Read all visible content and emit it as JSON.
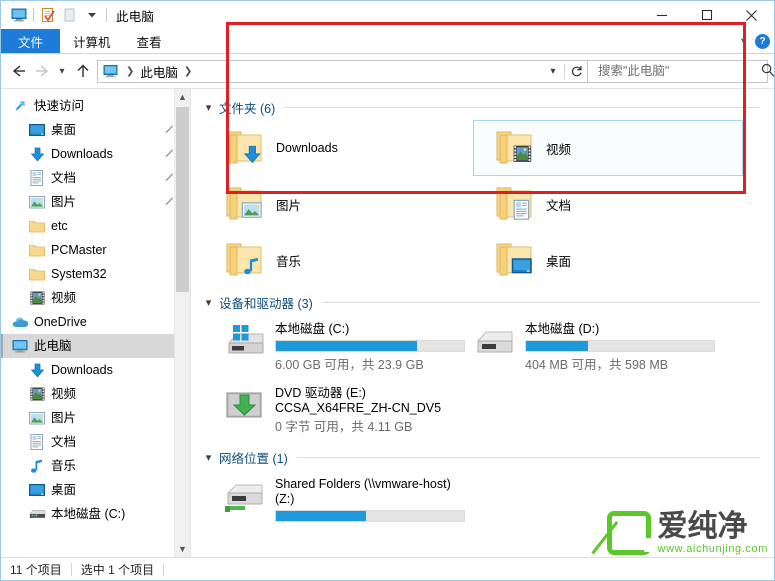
{
  "window": {
    "title": "此电脑",
    "quick_access_icons": [
      "monitor-icon",
      "properties-icon",
      "new-folder-icon",
      "customize-chevron-icon"
    ],
    "caption": {
      "minimize": "minimize-icon",
      "maximize": "maximize-icon",
      "close": "close-icon"
    }
  },
  "ribbon": {
    "tabs": [
      {
        "label": "文件",
        "active": true
      },
      {
        "label": "计算机",
        "active": false
      },
      {
        "label": "查看",
        "active": false
      }
    ],
    "expand_icon": "chevron-down-icon",
    "help_label": "?"
  },
  "nav": {
    "back": "back-arrow-icon",
    "forward": "forward-arrow-icon",
    "recent": "recent-chevron-icon",
    "up": "up-arrow-icon",
    "breadcrumb": {
      "root_icon": "this-pc-icon",
      "items": [
        "此电脑"
      ]
    },
    "history_icon": "chevron-down-icon",
    "refresh_icon": "refresh-icon"
  },
  "search": {
    "placeholder": "搜索\"此电脑\"",
    "value": "",
    "icon": "search-icon"
  },
  "sidebar": {
    "items": [
      {
        "label": "快速访问",
        "icon": "pin-star-icon",
        "indent": 0,
        "pinned": false,
        "selected": false
      },
      {
        "label": "桌面",
        "icon": "desktop-icon",
        "indent": 1,
        "pinned": true,
        "selected": false
      },
      {
        "label": "Downloads",
        "icon": "downloads-icon",
        "indent": 1,
        "pinned": true,
        "selected": false
      },
      {
        "label": "文档",
        "icon": "documents-icon",
        "indent": 1,
        "pinned": true,
        "selected": false
      },
      {
        "label": "图片",
        "icon": "pictures-icon",
        "indent": 1,
        "pinned": true,
        "selected": false
      },
      {
        "label": "etc",
        "icon": "folder-icon",
        "indent": 1,
        "pinned": false,
        "selected": false
      },
      {
        "label": "PCMaster",
        "icon": "folder-icon",
        "indent": 1,
        "pinned": false,
        "selected": false
      },
      {
        "label": "System32",
        "icon": "folder-icon",
        "indent": 1,
        "pinned": false,
        "selected": false
      },
      {
        "label": "视频",
        "icon": "videos-icon",
        "indent": 1,
        "pinned": false,
        "selected": false
      },
      {
        "label": "OneDrive",
        "icon": "onedrive-icon",
        "indent": 0,
        "pinned": false,
        "selected": false
      },
      {
        "label": "此电脑",
        "icon": "this-pc-icon",
        "indent": 0,
        "pinned": false,
        "selected": true
      },
      {
        "label": "Downloads",
        "icon": "downloads-icon",
        "indent": 1,
        "pinned": false,
        "selected": false
      },
      {
        "label": "视频",
        "icon": "videos-icon",
        "indent": 1,
        "pinned": false,
        "selected": false
      },
      {
        "label": "图片",
        "icon": "pictures-icon",
        "indent": 1,
        "pinned": false,
        "selected": false
      },
      {
        "label": "文档",
        "icon": "documents-icon",
        "indent": 1,
        "pinned": false,
        "selected": false
      },
      {
        "label": "音乐",
        "icon": "music-icon",
        "indent": 1,
        "pinned": false,
        "selected": false
      },
      {
        "label": "桌面",
        "icon": "desktop-icon",
        "indent": 1,
        "pinned": false,
        "selected": false
      },
      {
        "label": "本地磁盘 (C:)",
        "icon": "hard-drive-icon",
        "indent": 1,
        "pinned": false,
        "selected": false
      }
    ],
    "scrollbar": {
      "up": "scroll-up-icon",
      "down": "scroll-down-icon"
    }
  },
  "groups": {
    "folders": {
      "title": "文件夹 (6)",
      "count": 6,
      "chevron": "chevron-collapse-icon",
      "items": [
        {
          "label": "Downloads",
          "icon": "folder-downloads-icon",
          "selected": false
        },
        {
          "label": "视频",
          "icon": "folder-videos-icon",
          "selected": true
        },
        {
          "label": "图片",
          "icon": "folder-pictures-icon",
          "selected": false
        },
        {
          "label": "文档",
          "icon": "folder-documents-icon",
          "selected": false
        },
        {
          "label": "音乐",
          "icon": "folder-music-icon",
          "selected": false
        },
        {
          "label": "桌面",
          "icon": "folder-desktop-icon",
          "selected": false
        }
      ]
    },
    "devices": {
      "title": "设备和驱动器 (3)",
      "count": 3,
      "chevron": "chevron-collapse-icon",
      "items": [
        {
          "name": "本地磁盘 (C:)",
          "sub": "",
          "icon": "windows-drive-icon",
          "free_text": "6.00 GB 可用，共 23.9 GB",
          "used_percent": 75,
          "bar_color": "#1e9adb",
          "has_bar": true
        },
        {
          "name": "本地磁盘 (D:)",
          "sub": "",
          "icon": "local-drive-icon",
          "free_text": "404 MB 可用，共 598 MB",
          "used_percent": 33,
          "bar_color": "#1e9adb",
          "has_bar": true
        },
        {
          "name": "DVD 驱动器 (E:)",
          "sub": "CCSA_X64FRE_ZH-CN_DV5",
          "icon": "dvd-drive-icon",
          "free_text": "0 字节 可用，共 4.11 GB",
          "used_percent": 0,
          "bar_color": "#1e9adb",
          "has_bar": false
        }
      ]
    },
    "network": {
      "title": "网络位置 (1)",
      "count": 1,
      "chevron": "chevron-collapse-icon",
      "items": [
        {
          "name": "Shared Folders (\\\\vmware-host)",
          "sub": "(Z:)",
          "icon": "network-drive-icon",
          "free_text": "",
          "used_percent": 48,
          "bar_color": "#1e9adb",
          "has_bar": true
        }
      ]
    }
  },
  "highlight": {
    "color": "#e02020",
    "label": "red-annotation-box"
  },
  "watermark": {
    "brand": "爱纯净",
    "url": "www.aichunjing.com",
    "accent": "#5cc728"
  },
  "statusbar": {
    "items_text": "11 个项目",
    "selection_text": "选中 1 个项目"
  }
}
